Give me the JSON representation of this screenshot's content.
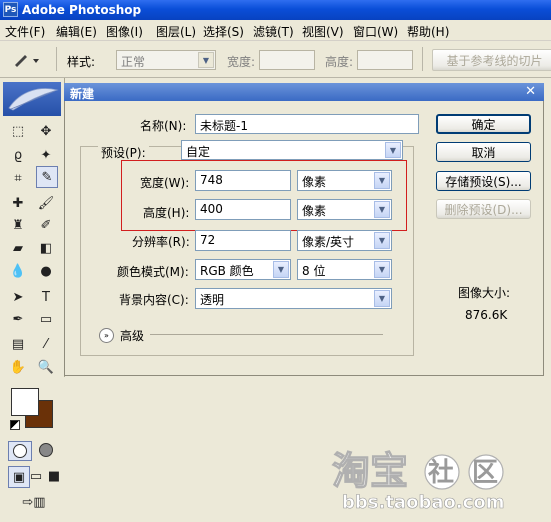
{
  "app": {
    "title": "Adobe Photoshop"
  },
  "menu": [
    "文件(F)",
    "编辑(E)",
    "图像(I)",
    "图层(L)",
    "选择(S)",
    "滤镜(T)",
    "视图(V)",
    "窗口(W)",
    "帮助(H)"
  ],
  "options_bar": {
    "style_label": "样式:",
    "style_value": "正常",
    "width_label": "宽度:",
    "height_label": "高度:",
    "guides_button": "基于参考线的切片"
  },
  "dialog": {
    "title": "新建",
    "name_label": "名称(N):",
    "name_value": "未标题-1",
    "preset_label": "预设(P):",
    "preset_value": "自定",
    "width_label": "宽度(W):",
    "width_value": "748",
    "width_unit": "像素",
    "height_label": "高度(H):",
    "height_value": "400",
    "height_unit": "像素",
    "resolution_label": "分辨率(R):",
    "resolution_value": "72",
    "resolution_unit": "像素/英寸",
    "color_mode_label": "颜色模式(M):",
    "color_mode_value": "RGB 颜色",
    "bit_depth_value": "8 位",
    "background_label": "背景内容(C):",
    "background_value": "透明",
    "advanced_label": "高级",
    "image_size_label": "图像大小:",
    "image_size_value": "876.6K",
    "buttons": {
      "ok": "确定",
      "cancel": "取消",
      "save_preset": "存储预设(S)...",
      "delete_preset": "删除预设(D)..."
    }
  },
  "watermark": {
    "logo_text": "淘宝社区",
    "url": "bbs.taobao.com"
  },
  "colors": {
    "foreground": "#ffffff",
    "background": "#6a3108",
    "accent": "#0a4ed8",
    "highlight_border": "#d21e1e"
  }
}
